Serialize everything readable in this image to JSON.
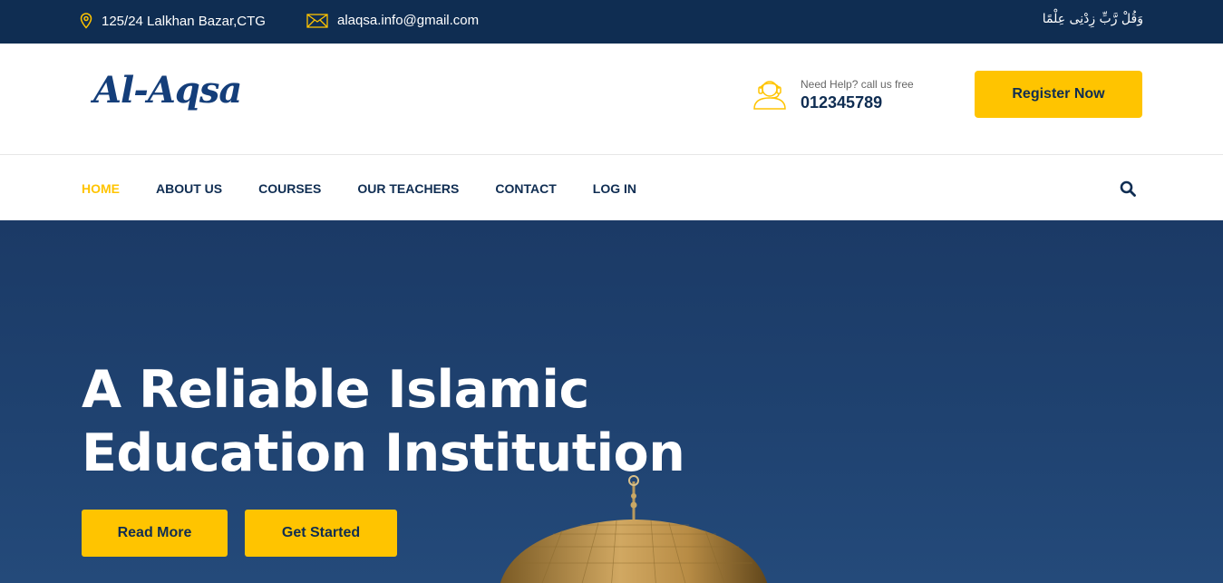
{
  "topbar": {
    "address": "125/24 Lalkhan Bazar,CTG",
    "email": "alaqsa.info@gmail.com",
    "arabic_text": "وَقُلْ رَّبِّ زِدْنِى عِلْمًا"
  },
  "header": {
    "logo": "Al-Aqsa",
    "help_label": "Need Help? call us free",
    "phone": "012345789",
    "register_label": "Register Now"
  },
  "nav": {
    "items": [
      "HOME",
      "ABOUT US",
      "COURSES",
      "OUR TEACHERS",
      "CONTACT",
      "LOG IN"
    ],
    "active": "HOME"
  },
  "hero": {
    "title_line1": "A Reliable Islamic",
    "title_line2": "Education Institution",
    "read_more": "Read More",
    "get_started": "Get Started"
  },
  "colors": {
    "navy": "#0f2d52",
    "accent": "#ffc400",
    "hero_bg": "#1f4270"
  },
  "icons": [
    "location-pin-icon",
    "envelope-icon",
    "support-agent-icon",
    "search-icon"
  ]
}
